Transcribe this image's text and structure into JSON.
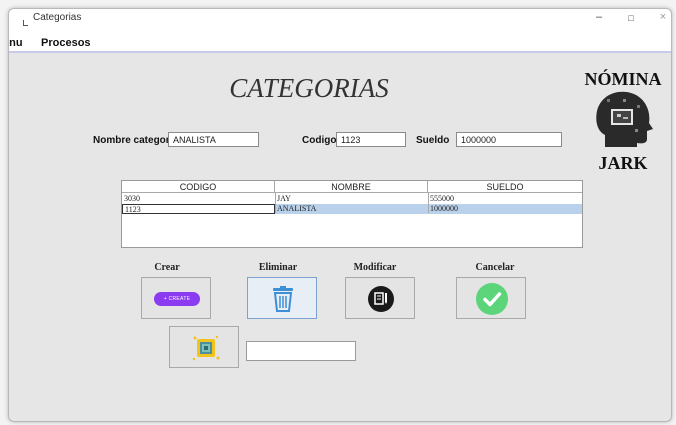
{
  "window": {
    "title": "Categorias",
    "minimize": "–",
    "maximize": "□",
    "close": "×"
  },
  "menu": [
    "enu",
    "Procesos"
  ],
  "heading": "CATEGORIAS",
  "logo": {
    "top": "NÓMINA",
    "bottom": "JARK"
  },
  "form": {
    "nombre_label": "Nombre categoria",
    "nombre_value": "ANALISTA",
    "codigo_label": "Codigo",
    "codigo_value": "1123",
    "sueldo_label": "Sueldo",
    "sueldo_value": "1000000"
  },
  "table": {
    "columns": [
      "CODIGO",
      "NOMBRE",
      "SUELDO"
    ],
    "rows": [
      [
        "3030",
        "JAY",
        "555000"
      ],
      [
        "1123",
        "ANALISTA",
        "1000000"
      ]
    ],
    "selected_row": 1
  },
  "actions": {
    "crear": "Crear",
    "create_pill": "+ CREATE",
    "eliminar": "Eliminar",
    "modificar": "Modificar",
    "cancelar": "Cancelar"
  },
  "icons": {
    "create": "create-pill-icon",
    "delete": "trash-icon",
    "modify": "document-edit-icon",
    "cancel": "checkmark-icon",
    "extra": "frame-icon"
  },
  "colors": {
    "create_pill": "#8b3cf0",
    "trash": "#3d8fd6",
    "check": "#5bd47a",
    "selection": "#b9d1ea"
  },
  "search": {
    "value": ""
  }
}
